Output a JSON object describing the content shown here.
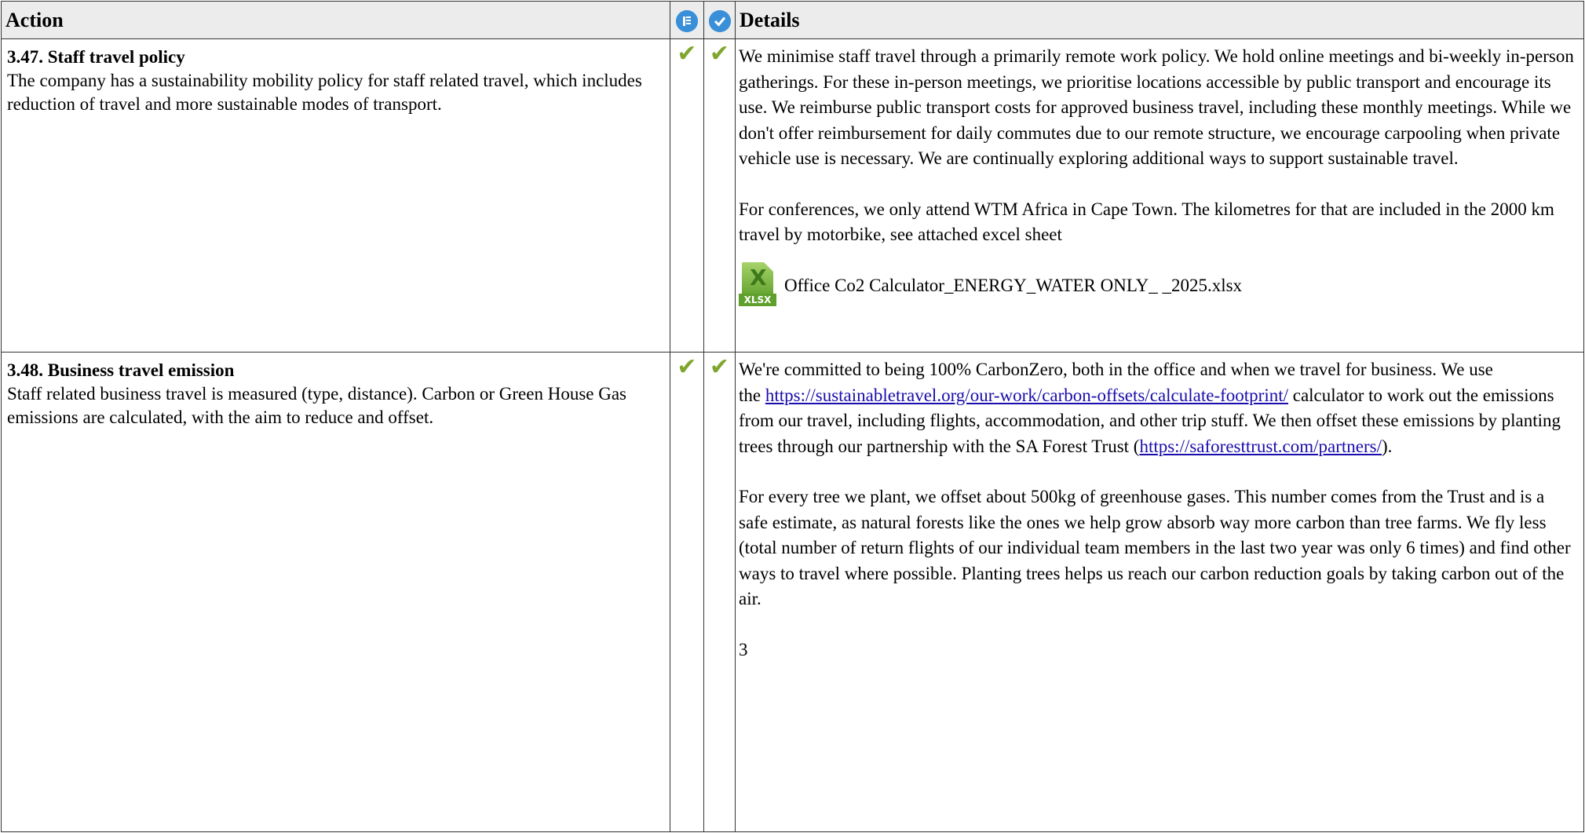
{
  "header": {
    "action_label": "Action",
    "details_label": "Details",
    "icon_1": "list-icon",
    "icon_2": "checkmark-circle-icon"
  },
  "rows": [
    {
      "title": "3.47. Staff travel policy",
      "description": "The company has a sustainability mobility policy for staff related travel, which includes reduction of travel and more sustainable modes of transport.",
      "check_1": "✔",
      "check_2": "✔",
      "paragraph_1": "We minimise staff travel through a primarily remote work policy. We hold online meetings and bi-weekly in-person gatherings. For these in-person meetings, we prioritise locations accessible by public transport and encourage its use. We reimburse public transport costs for approved business travel, including these monthly meetings. While we don't offer reimbursement for daily commutes due to our remote structure, we encourage carpooling when private vehicle use is necessary. We are continually exploring additional ways to support sustainable travel.",
      "paragraph_2": "For conferences, we only attend WTM Africa in Cape Town. The kilometres for that are included in the 2000 km travel by motorbike, see attached excel sheet",
      "attachment": {
        "icon": "xlsx-file-icon",
        "icon_letter": "X",
        "icon_label": "XLSX",
        "name": "Office Co2 Calculator_ENERGY_WATER ONLY_ _2025.xlsx"
      }
    },
    {
      "title": "3.48. Business travel emission",
      "description": "Staff related business travel is measured (type, distance). Carbon or Green House Gas emissions are calculated, with the aim to reduce and offset.",
      "check_1": "✔",
      "check_2": "✔",
      "paragraph_1_line_1": "We're committed to being 100% CarbonZero, both in the office and when we travel for business. We use",
      "paragraph_1_pre_link": "the ",
      "link_1": "https://sustainabletravel.org/our-work/carbon-offsets/calculate-footprint/",
      "paragraph_1_post_link": " calculator to work out the emissions from our travel, including flights, accommodation, and other trip stuff. We then offset these emissions by planting trees through our partnership with the SA Forest Trust (",
      "link_2": "https://saforesttrust.com/partners/",
      "paragraph_1_end": ").",
      "paragraph_2": "For every tree we plant, we offset about 500kg of greenhouse gases. This number comes from the Trust and is a safe estimate, as natural forests like the ones we help grow absorb way more carbon than tree farms. We fly less (total number of return flights of our individual team members in the last two year was only 6 times) and find other ways to travel where possible. Planting trees helps us reach our carbon reduction goals by taking carbon out of the air.",
      "paragraph_3": "3"
    }
  ],
  "colors": {
    "check": "#7fa62e",
    "header_bg": "#ececec",
    "icon_blue": "#3a90d8",
    "link": "#1a0dab"
  }
}
